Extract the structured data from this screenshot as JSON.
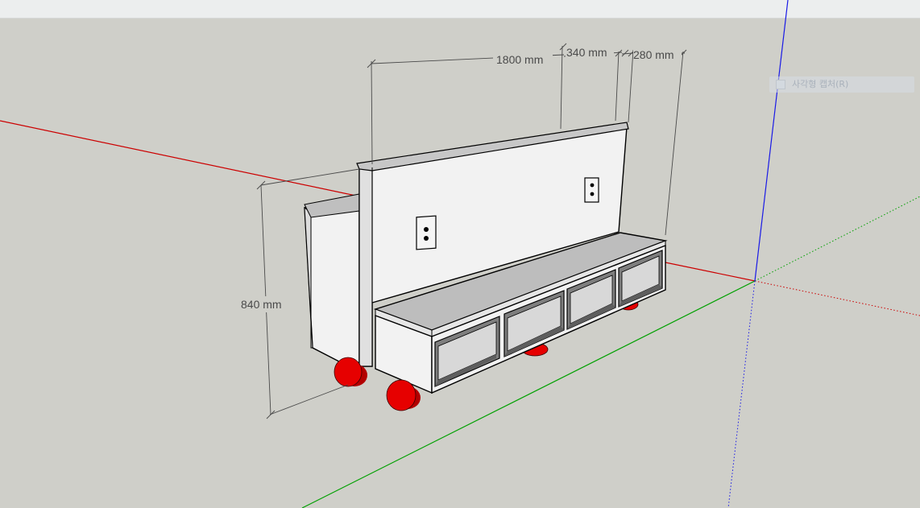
{
  "dimensions": {
    "width_total": "1800 mm",
    "width_middle": "340 mm",
    "width_right": "280 mm",
    "height": "840 mm"
  },
  "hint": {
    "label": "사각형 캡처(R)",
    "icon": "capture-rectangle-icon"
  },
  "colors": {
    "background": "#cfcfc9",
    "red_axis": "#cc0000",
    "green_axis": "#00a000",
    "blue_axis": "#1a1ae6",
    "wheel": "#e60000",
    "panel": "#f2f2f2",
    "shelf_top": "#b9b9b9",
    "edge": "#000000"
  }
}
